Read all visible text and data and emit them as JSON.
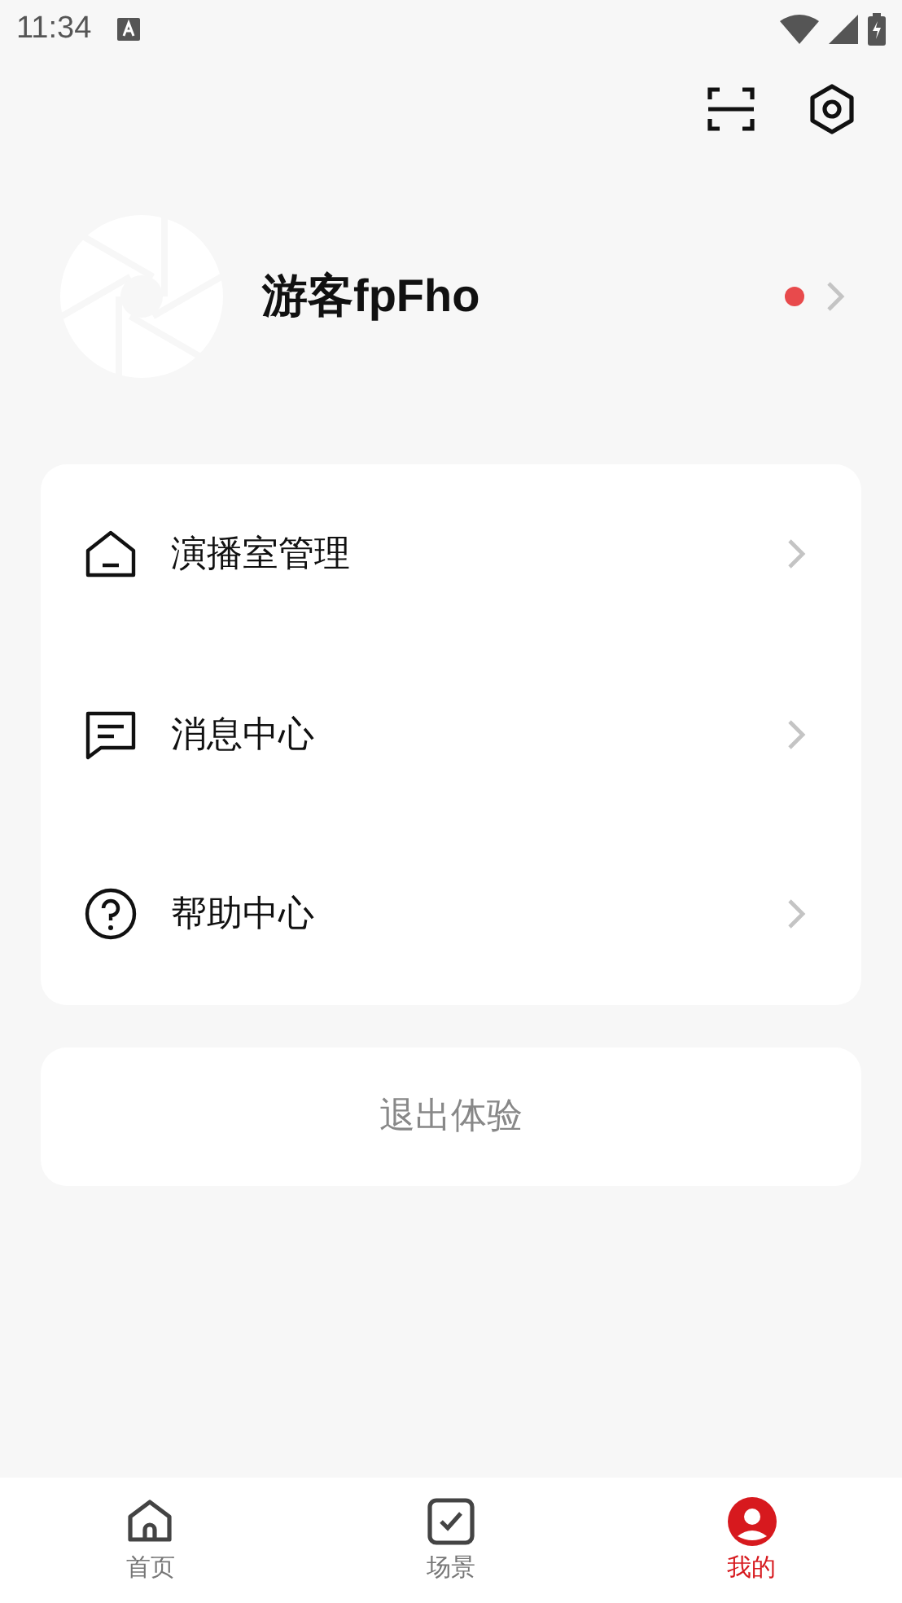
{
  "status_bar": {
    "time": "11:34"
  },
  "profile": {
    "name": "游客fpFho",
    "unread": true
  },
  "menu": [
    {
      "kind": "room",
      "label": "演播室管理"
    },
    {
      "kind": "message",
      "label": "消息中心"
    },
    {
      "kind": "help",
      "label": "帮助中心"
    }
  ],
  "logout_button": "退出体验",
  "tabs": [
    {
      "kind": "home",
      "label": "首页",
      "selected": false
    },
    {
      "kind": "scene",
      "label": "场景",
      "selected": false
    },
    {
      "kind": "mine",
      "label": "我的",
      "selected": true
    }
  ]
}
